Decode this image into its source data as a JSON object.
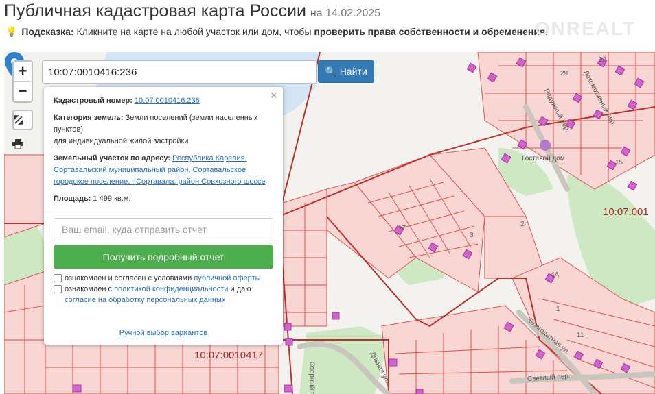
{
  "header": {
    "title": "Публичная кадастровая карта России",
    "date": "на 14.02.2025",
    "hint_prefix": "Подсказка:",
    "hint_text": "Кликните на карте на любой участок или дом, чтобы",
    "hint_bold": "проверить права собственности и обременения",
    "hint_end": ".",
    "watermark": "ONREALT"
  },
  "search": {
    "value": "10:07:0010416:236",
    "button_label": "Найти"
  },
  "controls": {
    "zoom_in": "+",
    "zoom_out": "−"
  },
  "popup": {
    "cad_label": "Кадастровый номер:",
    "cad_value": "10:07:0010416:236",
    "category_label": "Категория земель:",
    "category_value": "Земли поселений (земли населенных пунктов)",
    "category_use": "для индивидуальной жилой застройки",
    "address_label": "Земельный участок по адресу:",
    "address_value": "Республика Карелия, Сортавальский муниципальный район, Сортавальское городское поселение, г.Сортавала, район Совхозного шоссе",
    "area_label": "Площадь:",
    "area_value": "1 499 кв.м.",
    "email_placeholder": "Ваш email, куда отправить отчет",
    "report_button": "Получить подробный отчет",
    "check1_text": "ознакомлен и согласен с условиями",
    "check1_link": "публичной оферты",
    "check2_text": "ознакомлен с",
    "check2_link": "политикой конфиденциальности",
    "check2_mid": "и даю",
    "check2_link2": "согласие на обработку персональных данных",
    "manual_link": "Ручной выбор вариантов",
    "close": "×"
  },
  "map": {
    "cad_label_bottom": "10:07:0010417",
    "cad_label_right": "10:07:001",
    "guest_house": "Гостевой дом",
    "streets": [
      "Локомотивный пер.",
      "Радужный пер.",
      "Благодатная ул.",
      "Светлый пер.",
      "Дивная ул.",
      "Озерный пер."
    ],
    "numbers": [
      "29",
      "2",
      "3",
      "1",
      "4А",
      "11",
      "22",
      "17",
      "15"
    ]
  },
  "colors": {
    "parcel_fill": "#f7d6d3",
    "parcel_border": "#d9544f",
    "quarter_border": "#c0302b",
    "building": "#d65fd1",
    "water": "#d3e4f5",
    "forest": "#cfe8c4",
    "button_blue": "#337ab7",
    "button_green": "#4cae4c"
  }
}
